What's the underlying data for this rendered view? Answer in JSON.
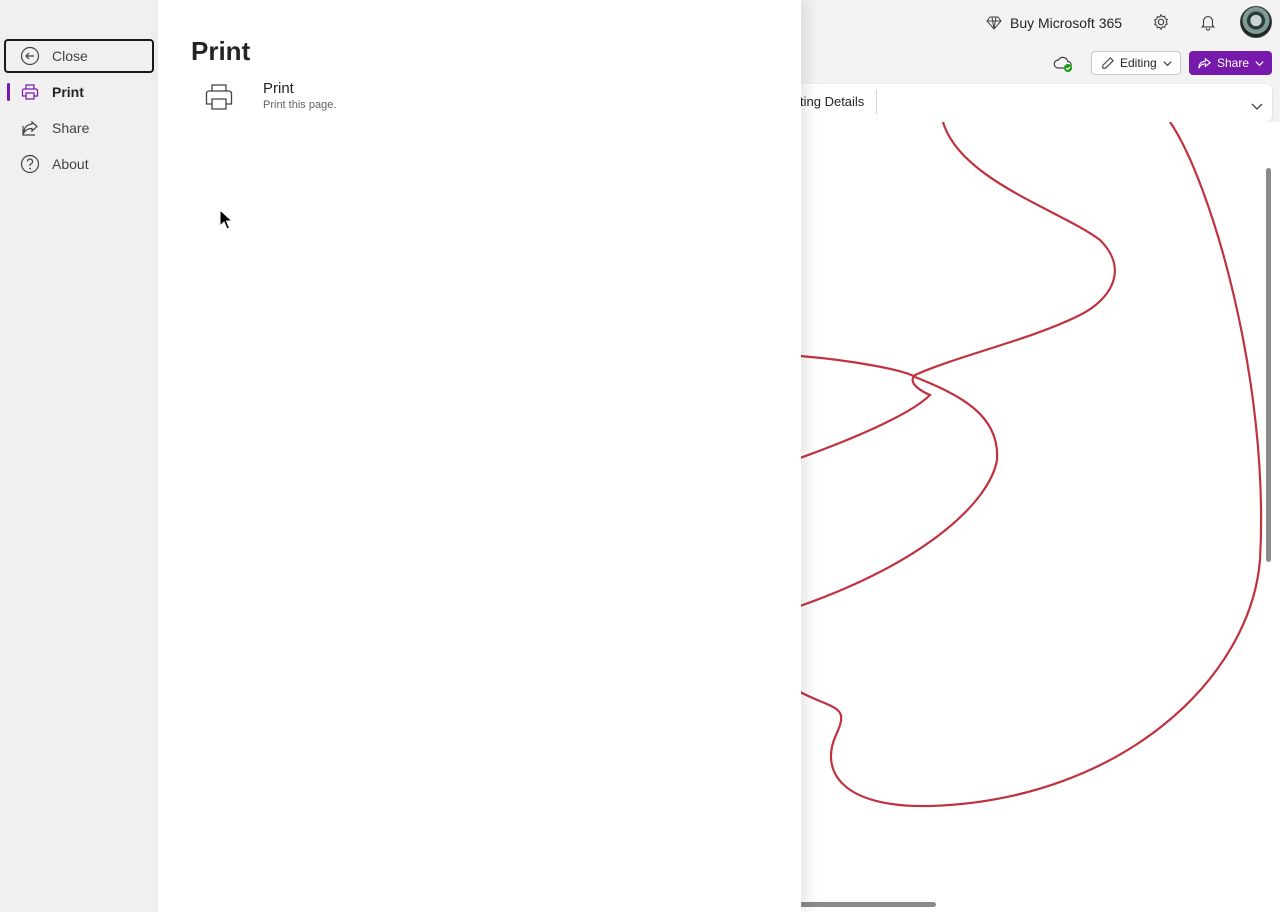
{
  "header": {
    "buy_label": "Buy Microsoft 365",
    "buy_icon": "diamond-icon",
    "settings_icon": "gear-icon",
    "notifications_icon": "bell-icon",
    "avatar_icon": "avatar"
  },
  "command_bar": {
    "sync_icon": "cloud-check-icon",
    "editing_label": "Editing",
    "share_label": "Share"
  },
  "ribbon": {
    "visible_text": "ting Details"
  },
  "backstage": {
    "nav": [
      {
        "label": "Close",
        "icon": "back-arrow-icon"
      },
      {
        "label": "Print",
        "icon": "printer-icon",
        "active": true
      },
      {
        "label": "Share",
        "icon": "share-icon"
      },
      {
        "label": "About",
        "icon": "question-icon"
      }
    ],
    "title": "Print",
    "option": {
      "title": "Print",
      "description": "Print this page."
    }
  },
  "colors": {
    "accent": "#7719aa",
    "ink_stroke": "#c0323f",
    "nav_bg": "#f0f0f0"
  }
}
